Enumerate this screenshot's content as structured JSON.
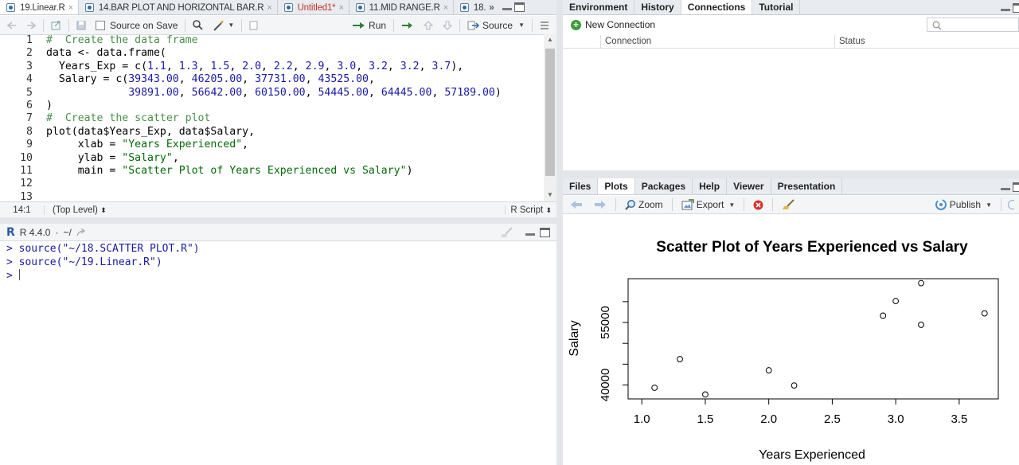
{
  "editor": {
    "tabs": [
      {
        "label": "19.Linear.R",
        "active": true,
        "unsaved": false
      },
      {
        "label": "14.BAR PLOT AND HORIZONTAL BAR.R",
        "active": false,
        "unsaved": false
      },
      {
        "label": "Untitled1*",
        "active": false,
        "unsaved": true
      },
      {
        "label": "11.MID RANGE.R",
        "active": false,
        "unsaved": false
      },
      {
        "label": "18.",
        "active": false,
        "unsaved": false
      }
    ],
    "overflow_label": "»",
    "toolbar": {
      "source_on_save": "Source on Save",
      "run": "Run",
      "source": "Source"
    },
    "line_numbers": [
      "1",
      "2",
      "3",
      "4",
      "5",
      "6",
      "7",
      "8",
      "9",
      "10",
      "11",
      "12",
      "13"
    ],
    "cursor_position": "14:1",
    "scope": "(Top Level)",
    "file_type": "R Script"
  },
  "console": {
    "version": "R 4.4.0",
    "path": "~/",
    "lines": [
      "> source(\"~/18.SCATTER PLOT.R\")",
      "> source(\"~/19.Linear.R\")"
    ],
    "prompt": ">"
  },
  "env_pane": {
    "tabs": [
      "Environment",
      "History",
      "Connections",
      "Tutorial"
    ],
    "active_tab": "Connections",
    "new_connection": "New Connection",
    "columns": [
      "Connection",
      "Status"
    ]
  },
  "plots_pane": {
    "tabs": [
      "Files",
      "Plots",
      "Packages",
      "Help",
      "Viewer",
      "Presentation"
    ],
    "active_tab": "Plots",
    "toolbar": {
      "zoom": "Zoom",
      "export": "Export",
      "publish": "Publish"
    }
  },
  "colors": {
    "accent": "#2e6da4",
    "comment": "#4b8f4b",
    "number": "#1a1aa6",
    "string": "#036a07"
  },
  "chart_data": {
    "type": "scatter",
    "title": "Scatter Plot of Years Experienced vs Salary",
    "xlabel": "Years Experienced",
    "ylabel": "Salary",
    "x": [
      1.1,
      1.3,
      1.5,
      2.0,
      2.2,
      2.9,
      3.0,
      3.2,
      3.2,
      3.7
    ],
    "y": [
      39343,
      46205,
      37731,
      43525,
      39891,
      56642,
      60150,
      54445,
      64445,
      57189
    ],
    "xlim": [
      1.0,
      3.7
    ],
    "ylim": [
      37731,
      64445
    ],
    "xticks": [
      "1.0",
      "1.5",
      "2.0",
      "2.5",
      "3.0",
      "3.5"
    ],
    "yticks": [
      "40000",
      "55000"
    ],
    "grid": false
  }
}
